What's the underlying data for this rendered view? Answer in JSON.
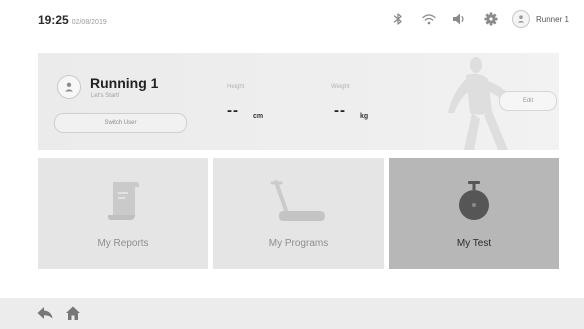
{
  "status_bar": {
    "time": "19:25",
    "date": "02/08/2019",
    "icons": [
      "bluetooth-icon",
      "wifi-icon",
      "volume-icon",
      "settings-gear-icon"
    ],
    "user_name": "Runner 1"
  },
  "profile": {
    "name": "Running 1",
    "subtitle": "Let's Start!",
    "switch_user_label": "Switch User",
    "height_label": "Height",
    "height_value": "--",
    "height_unit": "cm",
    "weight_label": "Weight",
    "weight_value": "--",
    "weight_unit": "kg",
    "edit_label": "Edit"
  },
  "tiles": [
    {
      "label": "My Reports",
      "icon": "reports-scroll-icon",
      "active": false
    },
    {
      "label": "My Programs",
      "icon": "treadmill-icon",
      "active": false
    },
    {
      "label": "My Test",
      "icon": "stopwatch-icon",
      "active": true
    }
  ],
  "bottom_nav": {
    "back": "back-arrow-icon",
    "home": "home-icon"
  },
  "colors": {
    "tile_bg": "#e5e5e5",
    "tile_active_bg": "#b7b7b7",
    "bottom_bar": "#ececec"
  }
}
